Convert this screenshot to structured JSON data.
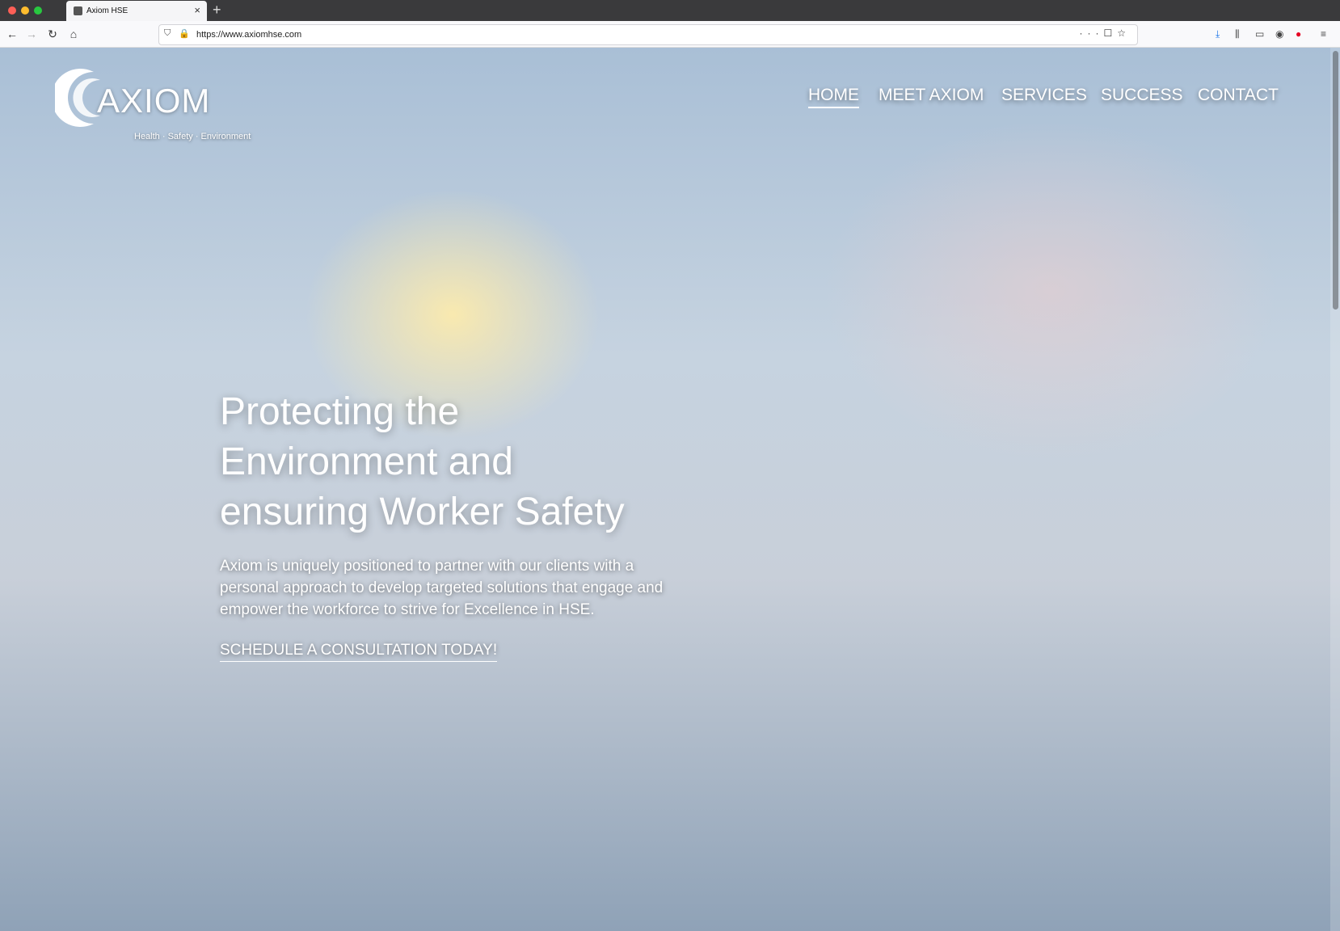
{
  "browser": {
    "tab_title": "Axiom HSE",
    "url_display": "https://www.axiomhse.com"
  },
  "site": {
    "logo_text": "AXIOM",
    "logo_tagline": "Health · Safety · Environment",
    "nav": [
      {
        "label": "HOME",
        "active": true
      },
      {
        "label": "MEET AXIOM",
        "active": false
      },
      {
        "label": "SERVICES",
        "active": false
      },
      {
        "label": "SUCCESS",
        "active": false
      },
      {
        "label": "CONTACT",
        "active": false
      }
    ],
    "hero": {
      "title": "Protecting the Environment and ensuring Worker Safety",
      "text": "Axiom is uniquely positioned to partner with our clients with a personal approach to develop targeted solutions that engage and empower the workforce to strive for Excellence in HSE.",
      "cta": "SCHEDULE A CONSULTATION TODAY!"
    }
  },
  "colors": {
    "nav_text": "#ffffff",
    "hero_text": "#ffffff"
  }
}
